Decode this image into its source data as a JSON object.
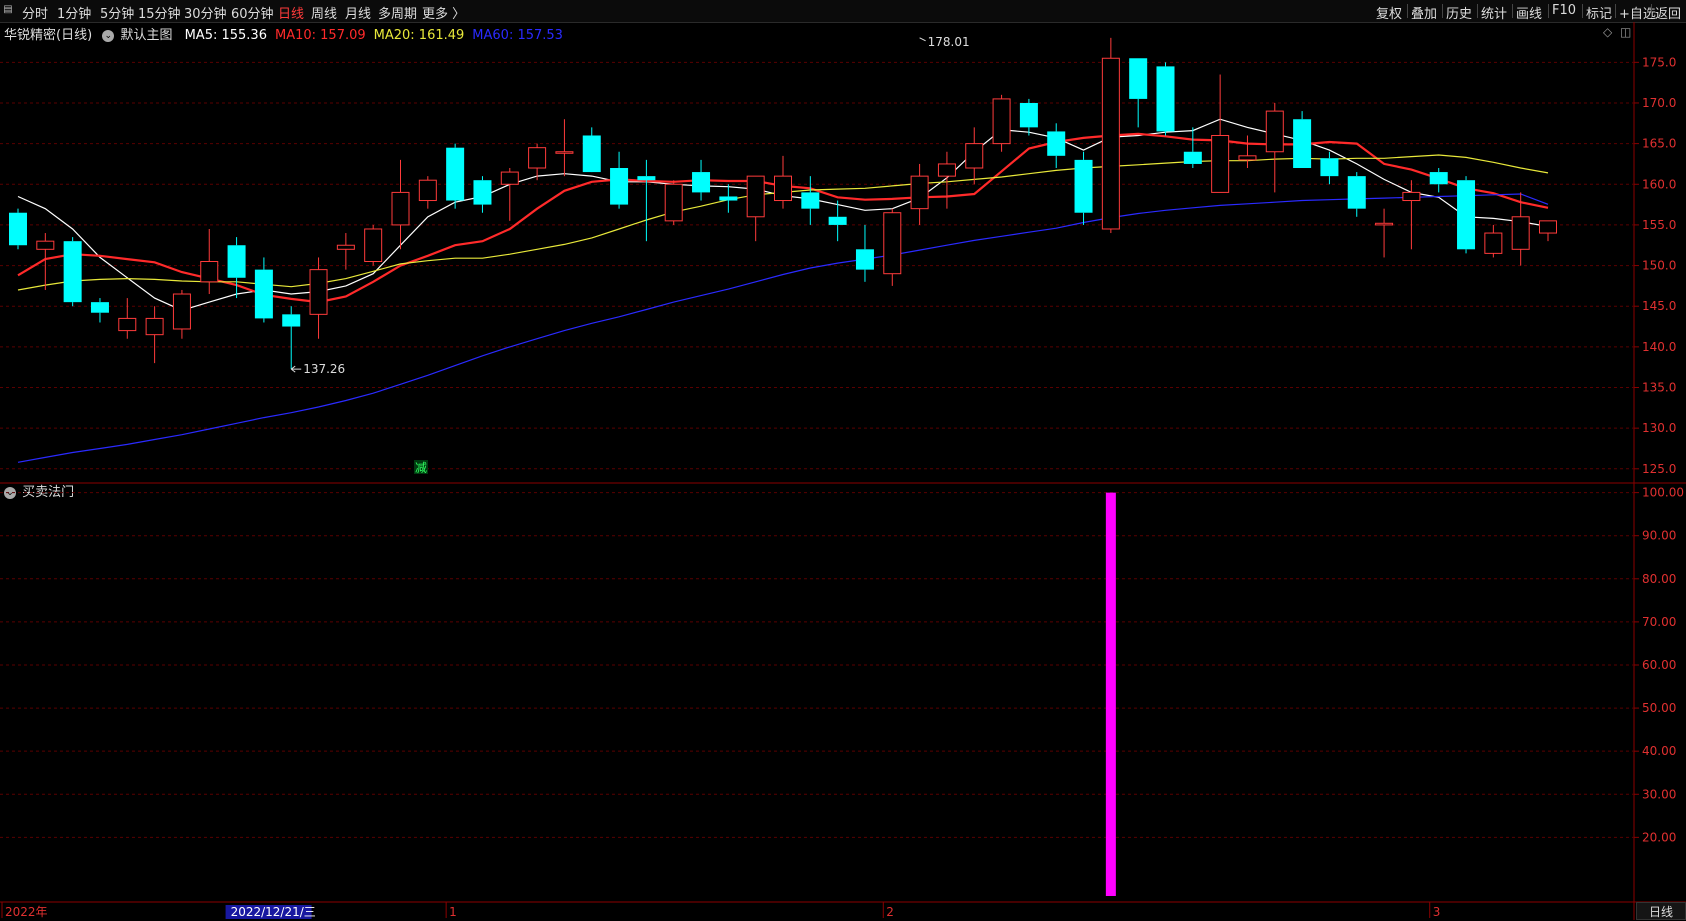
{
  "toolbar": {
    "periods": [
      "分时",
      "1分钟",
      "5分钟",
      "15分钟",
      "30分钟",
      "60分钟",
      "日线",
      "周线",
      "月线",
      "多周期",
      "更多 〉"
    ],
    "active_index": 6,
    "right_buttons": [
      "复权",
      "叠加",
      "历史",
      "统计",
      "画线",
      "F10",
      "标记",
      "+自选",
      "返回"
    ]
  },
  "main": {
    "title": "华锐精密(日线)",
    "template": "默认主图",
    "ma_labels": [
      {
        "text": "MA5: 155.36",
        "color": "#ffffff"
      },
      {
        "text": "MA10: 157.09",
        "color": "#ff2a2a"
      },
      {
        "text": "MA20: 161.49",
        "color": "#e8e83a"
      },
      {
        "text": "MA60: 157.53",
        "color": "#2a2aff"
      }
    ],
    "annotation": "减"
  },
  "sub": {
    "title": "买卖法门"
  },
  "bottom": {
    "period_label": "日线"
  },
  "chart_data": [
    {
      "type": "candlestick",
      "ylim": [
        123.5,
        177.5
      ],
      "yticks": [
        125,
        130,
        135,
        140,
        145,
        150,
        155,
        160,
        165,
        170,
        175
      ],
      "grid": true,
      "up_color": "#ff3b3b",
      "down_color": "#00ffff",
      "annotations": [
        {
          "text": "178.01",
          "index": 33,
          "value": 178.01
        },
        {
          "text": "137.26",
          "index": 10,
          "value": 137.26
        }
      ],
      "candles": [
        {
          "o": 156.5,
          "h": 157,
          "l": 152,
          "c": 152.5
        },
        {
          "o": 152,
          "h": 154,
          "l": 147,
          "c": 153
        },
        {
          "o": 153,
          "h": 153.5,
          "l": 145,
          "c": 145.5
        },
        {
          "o": 145.5,
          "h": 146,
          "l": 143,
          "c": 144.2
        },
        {
          "o": 142,
          "h": 146,
          "l": 141,
          "c": 143.5
        },
        {
          "o": 141.5,
          "h": 145,
          "l": 138,
          "c": 143.5
        },
        {
          "o": 142.2,
          "h": 147,
          "l": 141,
          "c": 146.5
        },
        {
          "o": 148,
          "h": 154.5,
          "l": 146.5,
          "c": 150.5
        },
        {
          "o": 152.5,
          "h": 153.5,
          "l": 146,
          "c": 148.5
        },
        {
          "o": 149.5,
          "h": 151,
          "l": 143,
          "c": 143.5
        },
        {
          "o": 144,
          "h": 145,
          "l": 137.26,
          "c": 142.5
        },
        {
          "o": 144,
          "h": 151,
          "l": 141,
          "c": 149.5
        },
        {
          "o": 152,
          "h": 154,
          "l": 149.5,
          "c": 152.5
        },
        {
          "o": 150.5,
          "h": 155,
          "l": 150,
          "c": 154.5
        },
        {
          "o": 155,
          "h": 163,
          "l": 152,
          "c": 159
        },
        {
          "o": 158,
          "h": 161,
          "l": 157,
          "c": 160.5
        },
        {
          "o": 164.5,
          "h": 165,
          "l": 157,
          "c": 158
        },
        {
          "o": 160.5,
          "h": 161,
          "l": 156.5,
          "c": 157.5
        },
        {
          "o": 160,
          "h": 162,
          "l": 155.5,
          "c": 161.5
        },
        {
          "o": 162,
          "h": 165,
          "l": 160.5,
          "c": 164.5
        },
        {
          "o": 164,
          "h": 168,
          "l": 161,
          "c": 164
        },
        {
          "o": 166,
          "h": 167,
          "l": 162,
          "c": 161.5
        },
        {
          "o": 162,
          "h": 164,
          "l": 157,
          "c": 157.5
        },
        {
          "o": 161,
          "h": 163,
          "l": 153,
          "c": 160.5
        },
        {
          "o": 155.5,
          "h": 160.5,
          "l": 155,
          "c": 160
        },
        {
          "o": 161.5,
          "h": 163,
          "l": 158,
          "c": 159
        },
        {
          "o": 158.5,
          "h": 160,
          "l": 156.5,
          "c": 158
        },
        {
          "o": 156,
          "h": 161,
          "l": 153,
          "c": 161
        },
        {
          "o": 158,
          "h": 163.5,
          "l": 157,
          "c": 161
        },
        {
          "o": 159,
          "h": 161,
          "l": 155,
          "c": 157
        },
        {
          "o": 156,
          "h": 158,
          "l": 153,
          "c": 155
        },
        {
          "o": 152,
          "h": 155,
          "l": 148,
          "c": 149.5
        },
        {
          "o": 149,
          "h": 157,
          "l": 147.5,
          "c": 156.5
        },
        {
          "o": 157,
          "h": 162.5,
          "l": 155,
          "c": 161
        },
        {
          "o": 161,
          "h": 164,
          "l": 157,
          "c": 162.5
        },
        {
          "o": 162,
          "h": 167,
          "l": 160,
          "c": 165
        },
        {
          "o": 165,
          "h": 171,
          "l": 164,
          "c": 170.5
        },
        {
          "o": 170,
          "h": 170.5,
          "l": 166,
          "c": 167
        },
        {
          "o": 166.5,
          "h": 167.5,
          "l": 162,
          "c": 163.5
        },
        {
          "o": 163,
          "h": 164,
          "l": 155,
          "c": 156.5
        },
        {
          "o": 154.5,
          "h": 178.01,
          "l": 154,
          "c": 175.5
        },
        {
          "o": 175.5,
          "h": 175.5,
          "l": 167,
          "c": 170.5
        },
        {
          "o": 174.5,
          "h": 175,
          "l": 166,
          "c": 166.5
        },
        {
          "o": 164,
          "h": 167,
          "l": 162,
          "c": 162.5
        },
        {
          "o": 159,
          "h": 173.5,
          "l": 159,
          "c": 166
        },
        {
          "o": 163,
          "h": 166,
          "l": 162,
          "c": 163.5
        },
        {
          "o": 164,
          "h": 170,
          "l": 159,
          "c": 169
        },
        {
          "o": 168,
          "h": 169,
          "l": 162,
          "c": 162
        },
        {
          "o": 163.2,
          "h": 164,
          "l": 160,
          "c": 161
        },
        {
          "o": 161,
          "h": 161.5,
          "l": 156,
          "c": 157
        },
        {
          "o": 155,
          "h": 157,
          "l": 151,
          "c": 155.2
        },
        {
          "o": 158,
          "h": 160.5,
          "l": 152,
          "c": 159
        },
        {
          "o": 161.5,
          "h": 162,
          "l": 159,
          "c": 160
        },
        {
          "o": 160.5,
          "h": 161,
          "l": 151.5,
          "c": 152
        },
        {
          "o": 151.5,
          "h": 155,
          "l": 151,
          "c": 154
        },
        {
          "o": 152,
          "h": 159,
          "l": 150,
          "c": 156
        },
        {
          "o": 154,
          "h": 155.5,
          "l": 153,
          "c": 155.5
        }
      ],
      "series": [
        {
          "name": "MA5",
          "color": "#ffffff",
          "width": 1.2,
          "values": [
            158.5,
            157,
            154.5,
            151,
            148.5,
            146,
            144.5,
            145.5,
            146.5,
            147,
            146.5,
            146.8,
            147.5,
            149,
            152.5,
            156,
            157.8,
            158.5,
            160,
            161,
            161.3,
            161,
            160.3,
            160.3,
            160,
            159.8,
            159.7,
            159.4,
            158.6,
            158.2,
            157.5,
            156.8,
            157,
            158.3,
            160.8,
            164,
            166.7,
            166.4,
            165.7,
            164.2,
            165.8,
            166,
            166.4,
            166.6,
            168,
            167,
            166.2,
            165.4,
            164.2,
            162.5,
            160.6,
            159,
            158.4,
            156,
            155.8,
            155.4,
            154.8
          ]
        },
        {
          "name": "MA10",
          "color": "#ff2a2a",
          "width": 2.2,
          "values": [
            148.8,
            150.8,
            151.4,
            151.2,
            150.8,
            150.4,
            149.2,
            148.4,
            147.6,
            146.4,
            145.9,
            145.5,
            146.2,
            148,
            150,
            151.2,
            152.5,
            153,
            154.5,
            157,
            159.2,
            160.3,
            160.6,
            160.4,
            160.3,
            160.5,
            160.4,
            160.4,
            159.8,
            159.5,
            158.4,
            158.1,
            158.2,
            158.4,
            158.5,
            158.8,
            161.6,
            164.4,
            165.2,
            165.7,
            166,
            166.2,
            165.9,
            165.5,
            165.4,
            165,
            164.9,
            164.9,
            165.2,
            165,
            162.5,
            161.8,
            160.7,
            159.5,
            158.9,
            157.8,
            157.1
          ]
        },
        {
          "name": "MA20",
          "color": "#e8e83a",
          "width": 1.2,
          "values": [
            147,
            147.6,
            148.1,
            148.3,
            148.4,
            148.3,
            148.1,
            148,
            148,
            147.7,
            147.4,
            147.8,
            148.4,
            149.3,
            150.2,
            150.6,
            150.9,
            150.9,
            151.4,
            152,
            152.6,
            153.4,
            154.5,
            155.6,
            156.6,
            157.3,
            158.1,
            158.7,
            159,
            159.3,
            159.4,
            159.5,
            159.8,
            160.1,
            160.3,
            160.6,
            160.9,
            161.3,
            161.7,
            162,
            162.2,
            162.4,
            162.6,
            162.8,
            162.9,
            162.9,
            163.1,
            163.2,
            163.1,
            163.2,
            163.2,
            163.4,
            163.6,
            163.3,
            162.7,
            162,
            161.4
          ]
        },
        {
          "name": "MA60",
          "color": "#2a2aff",
          "width": 1.2,
          "values": [
            125.8,
            126.4,
            127,
            127.5,
            128,
            128.6,
            129.2,
            129.9,
            130.6,
            131.3,
            131.9,
            132.6,
            133.4,
            134.3,
            135.4,
            136.5,
            137.7,
            138.9,
            140,
            141,
            142,
            142.9,
            143.7,
            144.6,
            145.5,
            146.3,
            147.1,
            148,
            148.9,
            149.7,
            150.3,
            150.8,
            151.3,
            151.9,
            152.5,
            153.1,
            153.6,
            154.1,
            154.6,
            155.3,
            155.9,
            156.4,
            156.8,
            157.1,
            157.4,
            157.6,
            157.8,
            158,
            158.1,
            158.2,
            158.3,
            158.4,
            158.5,
            158.6,
            158.7,
            158.8,
            157.53
          ]
        }
      ],
      "x_labels": [
        {
          "text": "2022年",
          "index": 0
        },
        {
          "text": "2022/12/21/三",
          "index": 8
        },
        {
          "text": "1",
          "index": 16
        },
        {
          "text": "2",
          "index": 32
        },
        {
          "text": "3",
          "index": 52
        }
      ]
    },
    {
      "type": "bar",
      "title": "买卖法门",
      "ylim": [
        5,
        102
      ],
      "yticks": [
        20,
        30,
        40,
        50,
        60,
        70,
        80,
        90,
        100
      ],
      "grid": true,
      "bars": [
        {
          "index": 40,
          "value": 100,
          "color": "#ff00ff"
        }
      ]
    }
  ]
}
